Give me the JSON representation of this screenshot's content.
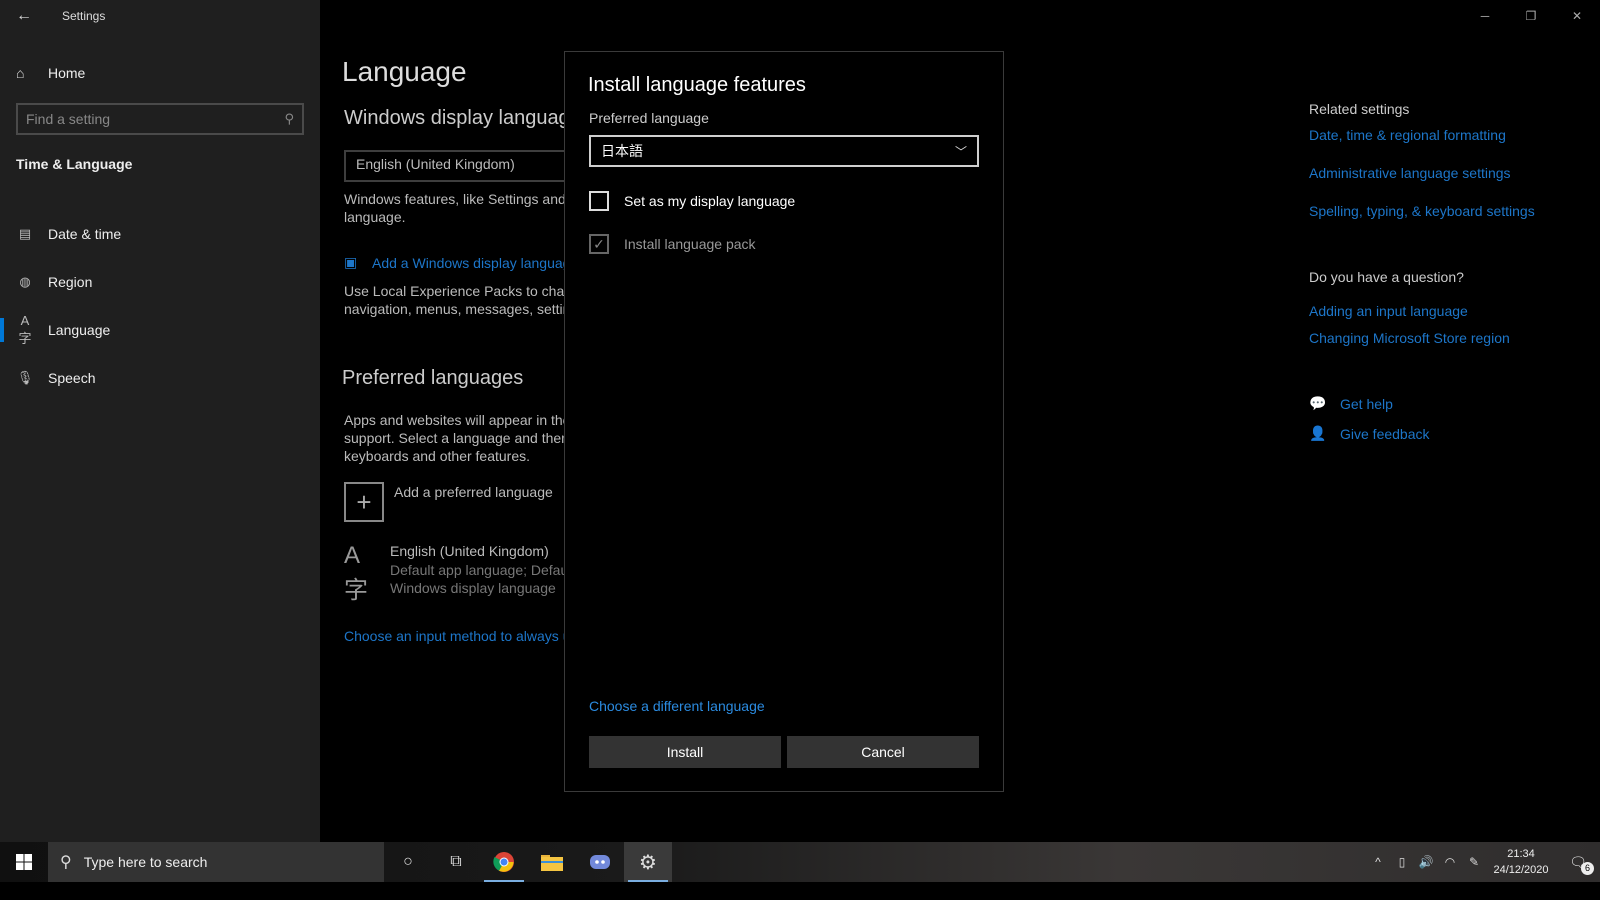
{
  "window": {
    "title": "Settings",
    "controls": {
      "minimize": "─",
      "restore": "❐",
      "close": "✕"
    }
  },
  "sidebar": {
    "home_label": "Home",
    "search_placeholder": "Find a setting",
    "section_title": "Time & Language",
    "items": [
      {
        "label": "Date & time",
        "icon": "calendar-clock-icon",
        "active": false
      },
      {
        "label": "Region",
        "icon": "globe-icon",
        "active": false
      },
      {
        "label": "Language",
        "icon": "language-icon",
        "active": true
      },
      {
        "label": "Speech",
        "icon": "microphone-icon",
        "active": false
      }
    ]
  },
  "main": {
    "page_title": "Language",
    "display_section_title": "Windows display language",
    "display_language_value": "English (United Kingdom)",
    "display_desc_line1": "Windows features, like Settings and File Explorer, will appear in this",
    "display_desc_line2": "language.",
    "add_display_link": "Add a Windows display language with Local Experience Packs",
    "lxp_desc_line1": "Use Local Experience Packs to change the language Windows uses for",
    "lxp_desc_line2": "navigation, menus, messages, settings, and help topics.",
    "preferred_title": "Preferred languages",
    "preferred_desc_line1": "Apps and websites will appear in the first language in the list that they",
    "preferred_desc_line2": "support. Select a language and then select Options to configure",
    "preferred_desc_line3": "keyboards and other features.",
    "add_preferred_label": "Add a preferred language",
    "language_entry": {
      "name": "English (United Kingdom)",
      "line2": "Default app language; Default input language",
      "line3": "Windows display language"
    },
    "input_method_link": "Choose an input method to always use as default"
  },
  "right": {
    "related_title": "Related settings",
    "related_links": [
      "Date, time & regional formatting",
      "Administrative language settings",
      "Spelling, typing, & keyboard settings"
    ],
    "question_title": "Do you have a question?",
    "question_links": [
      "Adding an input language",
      "Changing Microsoft Store region"
    ],
    "get_help": "Get help",
    "give_feedback": "Give feedback"
  },
  "dialog": {
    "title": "Install language features",
    "preferred_label": "Preferred language",
    "preferred_value": "日本語",
    "checkbox_display": {
      "label": "Set as my display language",
      "checked": false
    },
    "checkbox_pack": {
      "label": "Install language pack",
      "checked": true,
      "disabled": true
    },
    "different_language_link": "Choose a different language",
    "install_button": "Install",
    "cancel_button": "Cancel"
  },
  "taskbar": {
    "search_placeholder": "Type here to search",
    "time": "21:34",
    "date": "24/12/2020",
    "notification_count": "6"
  },
  "colors": {
    "accent": "#0078d7",
    "link": "#1d76c9",
    "sidebar_bg": "#1f1f1f"
  }
}
